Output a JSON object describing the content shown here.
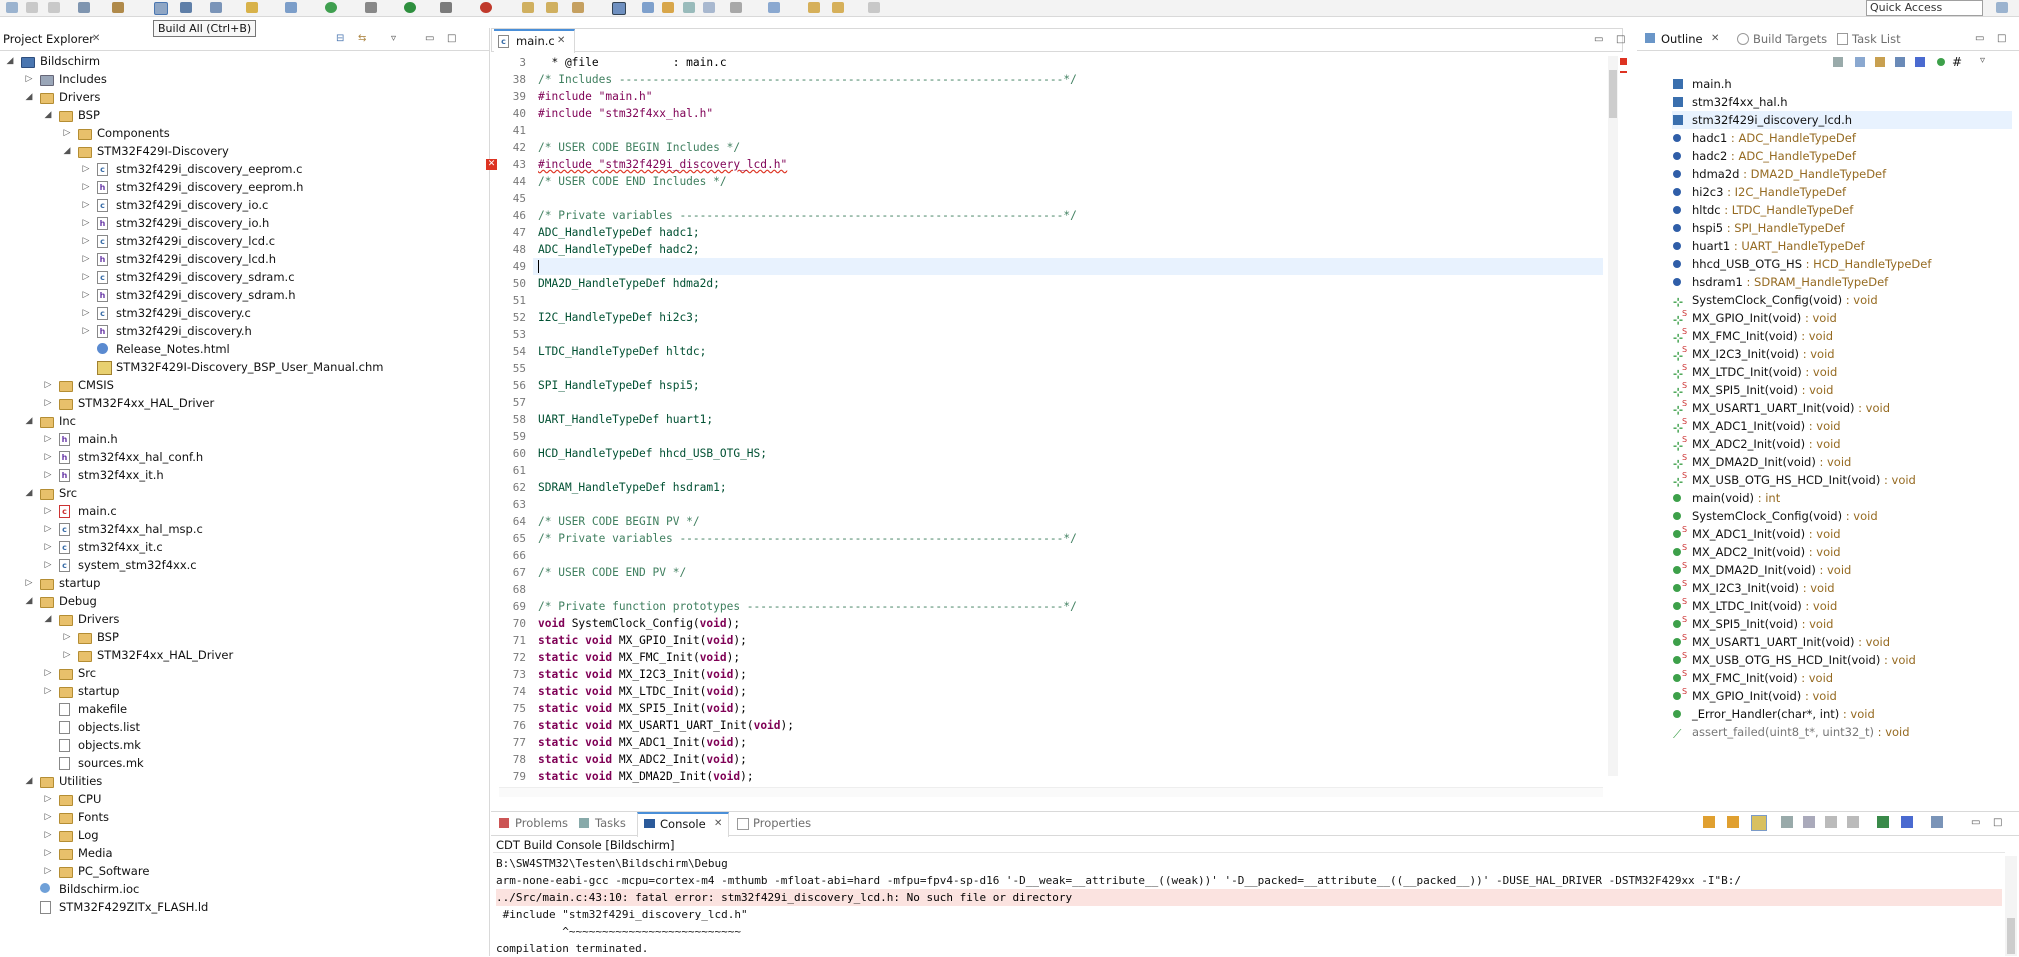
{
  "toolbar": {
    "tooltip": "Build All (Ctrl+B)",
    "quick_access": "Quick Access"
  },
  "project_explorer": {
    "title": "Project Explorer",
    "items": [
      {
        "label": "Bildschirm",
        "depth": 0,
        "icon": "project-icon",
        "expanded": true
      },
      {
        "label": "Includes",
        "depth": 1,
        "icon": "includes-icon",
        "expanded": false
      },
      {
        "label": "Drivers",
        "depth": 1,
        "icon": "source-folder-icon",
        "expanded": true
      },
      {
        "label": "BSP",
        "depth": 2,
        "icon": "folder-icon",
        "expanded": true
      },
      {
        "label": "Components",
        "depth": 3,
        "icon": "folder-icon",
        "expanded": false
      },
      {
        "label": "STM32F429I-Discovery",
        "depth": 3,
        "icon": "folder-icon",
        "expanded": true
      },
      {
        "label": "stm32f429i_discovery_eeprom.c",
        "depth": 4,
        "icon": "c-file-icon"
      },
      {
        "label": "stm32f429i_discovery_eeprom.h",
        "depth": 4,
        "icon": "h-file-icon"
      },
      {
        "label": "stm32f429i_discovery_io.c",
        "depth": 4,
        "icon": "c-file-icon"
      },
      {
        "label": "stm32f429i_discovery_io.h",
        "depth": 4,
        "icon": "h-file-icon"
      },
      {
        "label": "stm32f429i_discovery_lcd.c",
        "depth": 4,
        "icon": "c-file-icon"
      },
      {
        "label": "stm32f429i_discovery_lcd.h",
        "depth": 4,
        "icon": "h-file-icon"
      },
      {
        "label": "stm32f429i_discovery_sdram.c",
        "depth": 4,
        "icon": "c-file-icon"
      },
      {
        "label": "stm32f429i_discovery_sdram.h",
        "depth": 4,
        "icon": "h-file-icon"
      },
      {
        "label": "stm32f429i_discovery.c",
        "depth": 4,
        "icon": "c-file-icon"
      },
      {
        "label": "stm32f429i_discovery.h",
        "depth": 4,
        "icon": "h-file-icon"
      },
      {
        "label": "Release_Notes.html",
        "depth": 4,
        "icon": "html-file-icon",
        "leaf": true
      },
      {
        "label": "STM32F429I-Discovery_BSP_User_Manual.chm",
        "depth": 4,
        "icon": "chm-file-icon",
        "leaf": true
      },
      {
        "label": "CMSIS",
        "depth": 2,
        "icon": "folder-icon",
        "expanded": false
      },
      {
        "label": "STM32F4xx_HAL_Driver",
        "depth": 2,
        "icon": "folder-icon",
        "expanded": false
      },
      {
        "label": "Inc",
        "depth": 1,
        "icon": "source-folder-icon",
        "expanded": true
      },
      {
        "label": "main.h",
        "depth": 2,
        "icon": "h-file-icon"
      },
      {
        "label": "stm32f4xx_hal_conf.h",
        "depth": 2,
        "icon": "h-file-icon"
      },
      {
        "label": "stm32f4xx_it.h",
        "depth": 2,
        "icon": "h-file-icon"
      },
      {
        "label": "Src",
        "depth": 1,
        "icon": "source-folder-icon",
        "expanded": true
      },
      {
        "label": "main.c",
        "depth": 2,
        "icon": "c-file-error-icon"
      },
      {
        "label": "stm32f4xx_hal_msp.c",
        "depth": 2,
        "icon": "c-file-icon"
      },
      {
        "label": "stm32f4xx_it.c",
        "depth": 2,
        "icon": "c-file-icon"
      },
      {
        "label": "system_stm32f4xx.c",
        "depth": 2,
        "icon": "c-file-icon"
      },
      {
        "label": "startup",
        "depth": 1,
        "icon": "folder-icon",
        "expanded": false
      },
      {
        "label": "Debug",
        "depth": 1,
        "icon": "folder-icon",
        "expanded": true
      },
      {
        "label": "Drivers",
        "depth": 2,
        "icon": "folder-icon",
        "expanded": true
      },
      {
        "label": "BSP",
        "depth": 3,
        "icon": "folder-icon",
        "expanded": false
      },
      {
        "label": "STM32F4xx_HAL_Driver",
        "depth": 3,
        "icon": "folder-icon",
        "expanded": false
      },
      {
        "label": "Src",
        "depth": 2,
        "icon": "folder-icon",
        "expanded": false
      },
      {
        "label": "startup",
        "depth": 2,
        "icon": "folder-icon",
        "expanded": false
      },
      {
        "label": "makefile",
        "depth": 2,
        "icon": "file-icon",
        "leaf": true
      },
      {
        "label": "objects.list",
        "depth": 2,
        "icon": "file-icon",
        "leaf": true
      },
      {
        "label": "objects.mk",
        "depth": 2,
        "icon": "file-icon",
        "leaf": true
      },
      {
        "label": "sources.mk",
        "depth": 2,
        "icon": "file-icon",
        "leaf": true
      },
      {
        "label": "Utilities",
        "depth": 1,
        "icon": "folder-icon",
        "expanded": true
      },
      {
        "label": "CPU",
        "depth": 2,
        "icon": "folder-icon",
        "expanded": false
      },
      {
        "label": "Fonts",
        "depth": 2,
        "icon": "folder-icon",
        "expanded": false
      },
      {
        "label": "Log",
        "depth": 2,
        "icon": "folder-icon",
        "expanded": false
      },
      {
        "label": "Media",
        "depth": 2,
        "icon": "folder-icon",
        "expanded": false
      },
      {
        "label": "PC_Software",
        "depth": 2,
        "icon": "folder-icon",
        "expanded": false
      },
      {
        "label": "Bildschirm.ioc",
        "depth": 1,
        "icon": "ioc-file-icon",
        "leaf": true
      },
      {
        "label": "STM32F429ZITx_FLASH.ld",
        "depth": 1,
        "icon": "file-icon",
        "leaf": true
      }
    ]
  },
  "editor": {
    "tab": "main.c",
    "lines": [
      {
        "n": "3",
        "code": "  * @file           : main.c"
      },
      {
        "n": "38",
        "code": "/* Includes ------------------------------------------------------------------*/",
        "cls": "cm"
      },
      {
        "n": "39",
        "code": "#include \"main.h\"",
        "cls": "pp"
      },
      {
        "n": "40",
        "code": "#include \"stm32f4xx_hal.h\"",
        "cls": "pp"
      },
      {
        "n": "41",
        "code": ""
      },
      {
        "n": "42",
        "code": "/* USER CODE BEGIN Includes */",
        "cls": "cm"
      },
      {
        "n": "43",
        "code": "#include \"stm32f429i_discovery_lcd.h\"",
        "cls": "pp",
        "error": true
      },
      {
        "n": "44",
        "code": "/* USER CODE END Includes */",
        "cls": "cm"
      },
      {
        "n": "45",
        "code": ""
      },
      {
        "n": "46",
        "code": "/* Private variables ---------------------------------------------------------*/",
        "cls": "cm"
      },
      {
        "n": "47",
        "code": "ADC_HandleTypeDef hadc1;",
        "cls": "ty"
      },
      {
        "n": "48",
        "code": "ADC_HandleTypeDef hadc2;",
        "cls": "ty"
      },
      {
        "n": "49",
        "code": "",
        "current": true
      },
      {
        "n": "50",
        "code": "DMA2D_HandleTypeDef hdma2d;",
        "cls": "ty"
      },
      {
        "n": "51",
        "code": ""
      },
      {
        "n": "52",
        "code": "I2C_HandleTypeDef hi2c3;",
        "cls": "ty"
      },
      {
        "n": "53",
        "code": ""
      },
      {
        "n": "54",
        "code": "LTDC_HandleTypeDef hltdc;",
        "cls": "ty"
      },
      {
        "n": "55",
        "code": ""
      },
      {
        "n": "56",
        "code": "SPI_HandleTypeDef hspi5;",
        "cls": "ty"
      },
      {
        "n": "57",
        "code": ""
      },
      {
        "n": "58",
        "code": "UART_HandleTypeDef huart1;",
        "cls": "ty"
      },
      {
        "n": "59",
        "code": ""
      },
      {
        "n": "60",
        "code": "HCD_HandleTypeDef hhcd_USB_OTG_HS;",
        "cls": "ty"
      },
      {
        "n": "61",
        "code": ""
      },
      {
        "n": "62",
        "code": "SDRAM_HandleTypeDef hsdram1;",
        "cls": "ty"
      },
      {
        "n": "63",
        "code": ""
      },
      {
        "n": "64",
        "code": "/* USER CODE BEGIN PV */",
        "cls": "cm"
      },
      {
        "n": "65",
        "code": "/* Private variables ---------------------------------------------------------*/",
        "cls": "cm"
      },
      {
        "n": "66",
        "code": ""
      },
      {
        "n": "67",
        "code": "/* USER CODE END PV */",
        "cls": "cm"
      },
      {
        "n": "68",
        "code": ""
      },
      {
        "n": "69",
        "code": "/* Private function prototypes -----------------------------------------------*/",
        "cls": "cm"
      },
      {
        "n": "70",
        "code": "void SystemClock_Config(void);",
        "cls": "fn"
      },
      {
        "n": "71",
        "code": "static void MX_GPIO_Init(void);",
        "cls": "fn"
      },
      {
        "n": "72",
        "code": "static void MX_FMC_Init(void);",
        "cls": "fn"
      },
      {
        "n": "73",
        "code": "static void MX_I2C3_Init(void);",
        "cls": "fn"
      },
      {
        "n": "74",
        "code": "static void MX_LTDC_Init(void);",
        "cls": "fn"
      },
      {
        "n": "75",
        "code": "static void MX_SPI5_Init(void);",
        "cls": "fn"
      },
      {
        "n": "76",
        "code": "static void MX_USART1_UART_Init(void);",
        "cls": "fn"
      },
      {
        "n": "77",
        "code": "static void MX_ADC1_Init(void);",
        "cls": "fn"
      },
      {
        "n": "78",
        "code": "static void MX_ADC2_Init(void);",
        "cls": "fn"
      },
      {
        "n": "79",
        "code": "static void MX_DMA2D_Init(void);",
        "cls": "fn"
      }
    ]
  },
  "outline": {
    "tabs": [
      "Outline",
      "Build Targets",
      "Task List"
    ],
    "items": [
      {
        "name": "main.h",
        "type": "",
        "icon": "include-icon"
      },
      {
        "name": "stm32f4xx_hal.h",
        "type": "",
        "icon": "include-icon"
      },
      {
        "name": "stm32f429i_discovery_lcd.h",
        "type": "",
        "icon": "include-icon",
        "selected": true
      },
      {
        "name": "hadc1",
        "type": " : ADC_HandleTypeDef",
        "icon": "variable-icon"
      },
      {
        "name": "hadc2",
        "type": " : ADC_HandleTypeDef",
        "icon": "variable-icon"
      },
      {
        "name": "hdma2d",
        "type": " : DMA2D_HandleTypeDef",
        "icon": "variable-icon"
      },
      {
        "name": "hi2c3",
        "type": " : I2C_HandleTypeDef",
        "icon": "variable-icon"
      },
      {
        "name": "hltdc",
        "type": " : LTDC_HandleTypeDef",
        "icon": "variable-icon"
      },
      {
        "name": "hspi5",
        "type": " : SPI_HandleTypeDef",
        "icon": "variable-icon"
      },
      {
        "name": "huart1",
        "type": " : UART_HandleTypeDef",
        "icon": "variable-icon"
      },
      {
        "name": "hhcd_USB_OTG_HS",
        "type": " : HCD_HandleTypeDef",
        "icon": "variable-icon"
      },
      {
        "name": "hsdram1",
        "type": " : SDRAM_HandleTypeDef",
        "icon": "variable-icon"
      },
      {
        "name": "SystemClock_Config(void)",
        "type": " : void",
        "icon": "function-decl-icon"
      },
      {
        "name": "MX_GPIO_Init(void)",
        "type": " : void",
        "icon": "static-function-decl-icon"
      },
      {
        "name": "MX_FMC_Init(void)",
        "type": " : void",
        "icon": "static-function-decl-icon"
      },
      {
        "name": "MX_I2C3_Init(void)",
        "type": " : void",
        "icon": "static-function-decl-icon"
      },
      {
        "name": "MX_LTDC_Init(void)",
        "type": " : void",
        "icon": "static-function-decl-icon"
      },
      {
        "name": "MX_SPI5_Init(void)",
        "type": " : void",
        "icon": "static-function-decl-icon"
      },
      {
        "name": "MX_USART1_UART_Init(void)",
        "type": " : void",
        "icon": "static-function-decl-icon"
      },
      {
        "name": "MX_ADC1_Init(void)",
        "type": " : void",
        "icon": "static-function-decl-icon"
      },
      {
        "name": "MX_ADC2_Init(void)",
        "type": " : void",
        "icon": "static-function-decl-icon"
      },
      {
        "name": "MX_DMA2D_Init(void)",
        "type": " : void",
        "icon": "static-function-decl-icon"
      },
      {
        "name": "MX_USB_OTG_HS_HCD_Init(void)",
        "type": " : void",
        "icon": "static-function-decl-icon"
      },
      {
        "name": "main(void)",
        "type": " : int",
        "icon": "function-icon"
      },
      {
        "name": "SystemClock_Config(void)",
        "type": " : void",
        "icon": "function-icon"
      },
      {
        "name": "MX_ADC1_Init(void)",
        "type": " : void",
        "icon": "static-function-icon"
      },
      {
        "name": "MX_ADC2_Init(void)",
        "type": " : void",
        "icon": "static-function-icon"
      },
      {
        "name": "MX_DMA2D_Init(void)",
        "type": " : void",
        "icon": "static-function-icon"
      },
      {
        "name": "MX_I2C3_Init(void)",
        "type": " : void",
        "icon": "static-function-icon"
      },
      {
        "name": "MX_LTDC_Init(void)",
        "type": " : void",
        "icon": "static-function-icon"
      },
      {
        "name": "MX_SPI5_Init(void)",
        "type": " : void",
        "icon": "static-function-icon"
      },
      {
        "name": "MX_USART1_UART_Init(void)",
        "type": " : void",
        "icon": "static-function-icon"
      },
      {
        "name": "MX_USB_OTG_HS_HCD_Init(void)",
        "type": " : void",
        "icon": "static-function-icon"
      },
      {
        "name": "MX_FMC_Init(void)",
        "type": " : void",
        "icon": "static-function-icon"
      },
      {
        "name": "MX_GPIO_Init(void)",
        "type": " : void",
        "icon": "static-function-icon"
      },
      {
        "name": "_Error_Handler(char*, int)",
        "type": " : void",
        "icon": "function-icon"
      },
      {
        "name": "assert_failed(uint8_t*, uint32_t)",
        "type": " : void",
        "icon": "inactive-function-icon",
        "dim": true
      }
    ]
  },
  "bottom": {
    "tabs": [
      "Problems",
      "Tasks",
      "Console",
      "Properties"
    ],
    "active_tab": "Console",
    "console_title": "CDT Build Console [Bildschirm]",
    "lines": [
      {
        "text": "B:\\SW4STM32\\Testen\\Bildschirm\\Debug",
        "error": false
      },
      {
        "text": "arm-none-eabi-gcc -mcpu=cortex-m4 -mthumb -mfloat-abi=hard -mfpu=fpv4-sp-d16 '-D__weak=__attribute__((weak))' '-D__packed=__attribute__((__packed__))' -DUSE_HAL_DRIVER -DSTM32F429xx -I\"B:/",
        "error": false
      },
      {
        "text": "../Src/main.c:43:10: fatal error: stm32f429i_discovery_lcd.h: No such file or directory",
        "error": true
      },
      {
        "text": " #include \"stm32f429i_discovery_lcd.h\"",
        "error": false
      },
      {
        "text": "          ^~~~~~~~~~~~~~~~~~~~~~~~~~~",
        "error": false
      },
      {
        "text": "compilation terminated.",
        "error": false
      }
    ]
  },
  "colors": {
    "comment": "#3f7f5f",
    "keyword": "#7f0055",
    "type": "#005032",
    "error_bg": "#fbe3e0",
    "selection": "#e8f2fe",
    "outline_type": "#956a21"
  }
}
